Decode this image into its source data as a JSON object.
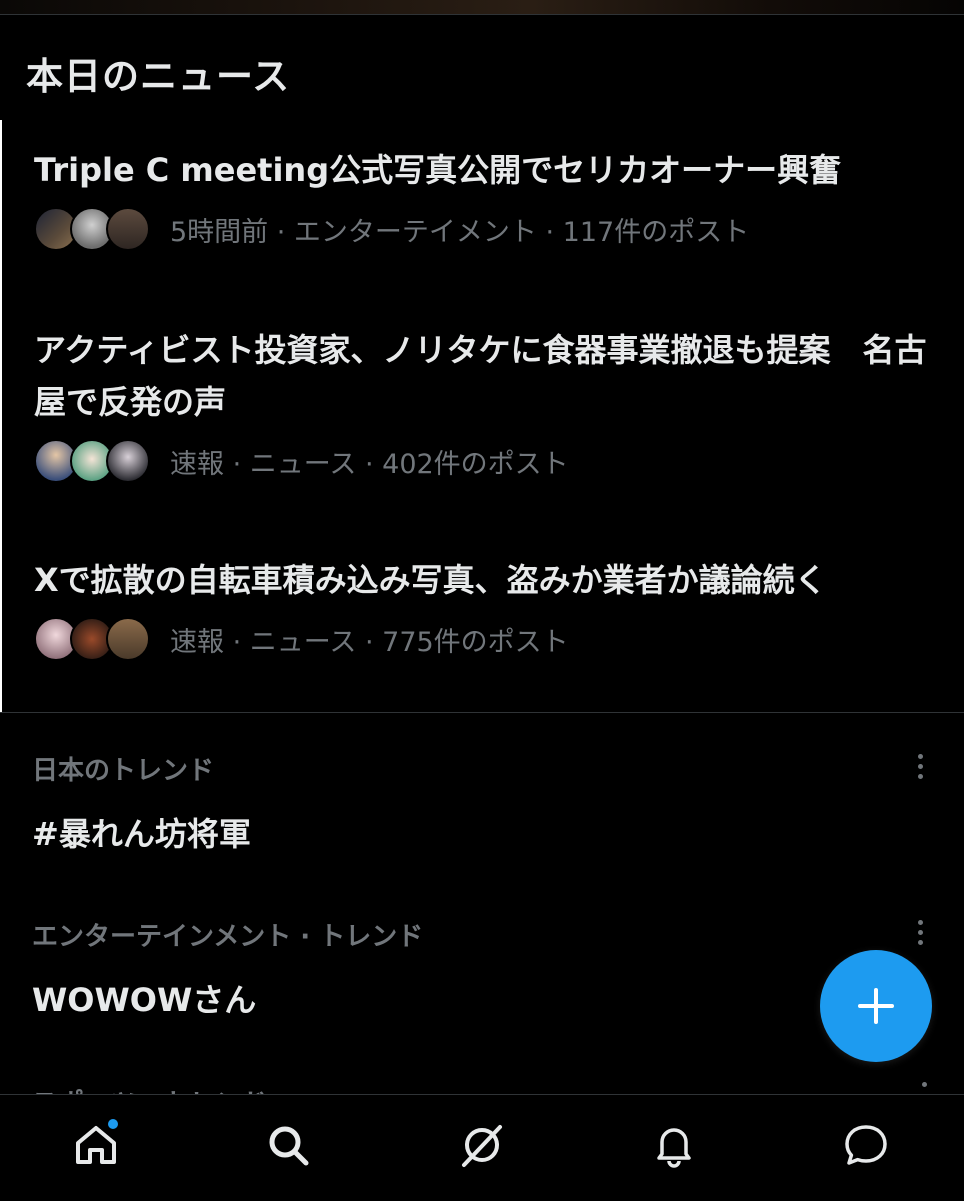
{
  "section": {
    "title": "本日のニュース"
  },
  "news": [
    {
      "title": "Triple C meeting公式写真公開でセリカオーナー興奮",
      "meta": "5時間前 · エンターテイメント · 117件のポスト",
      "avatars": [
        "#3b3a3c",
        "#8a8a8a",
        "#4a3f38"
      ]
    },
    {
      "title": "アクティビスト投資家、ノリタケに食器事業撤退も提案　名古屋で反発の声",
      "meta": "速報 · ニュース · 402件のポスト",
      "avatars": [
        "#c9a98a",
        "#e8d3c4",
        "#6a5f66"
      ]
    },
    {
      "title": "Xで拡散の自転車積み込み写真、盗みか業者か議論続く",
      "meta": "速報 · ニュース · 775件のポスト",
      "avatars": [
        "#b89ea4",
        "#5a3a2a",
        "#7a5a40"
      ]
    }
  ],
  "trends": [
    {
      "category": "日本のトレンド",
      "name": "#暴れん坊将軍"
    },
    {
      "category": "エンターテインメント · トレンド",
      "name": "WOWOWさん"
    },
    {
      "category": "スポーツ · トレンド",
      "name": ""
    }
  ],
  "colors": {
    "accent": "#1d9bf0",
    "background": "#000000",
    "primary_text": "#e7e9ea",
    "secondary_text": "#71767b"
  },
  "fab": {
    "icon": "plus-icon"
  },
  "nav": {
    "items": [
      {
        "icon": "home-icon",
        "has_notification_dot": true
      },
      {
        "icon": "search-icon"
      },
      {
        "icon": "grok-icon"
      },
      {
        "icon": "bell-icon"
      },
      {
        "icon": "chat-bubble-icon"
      }
    ]
  }
}
